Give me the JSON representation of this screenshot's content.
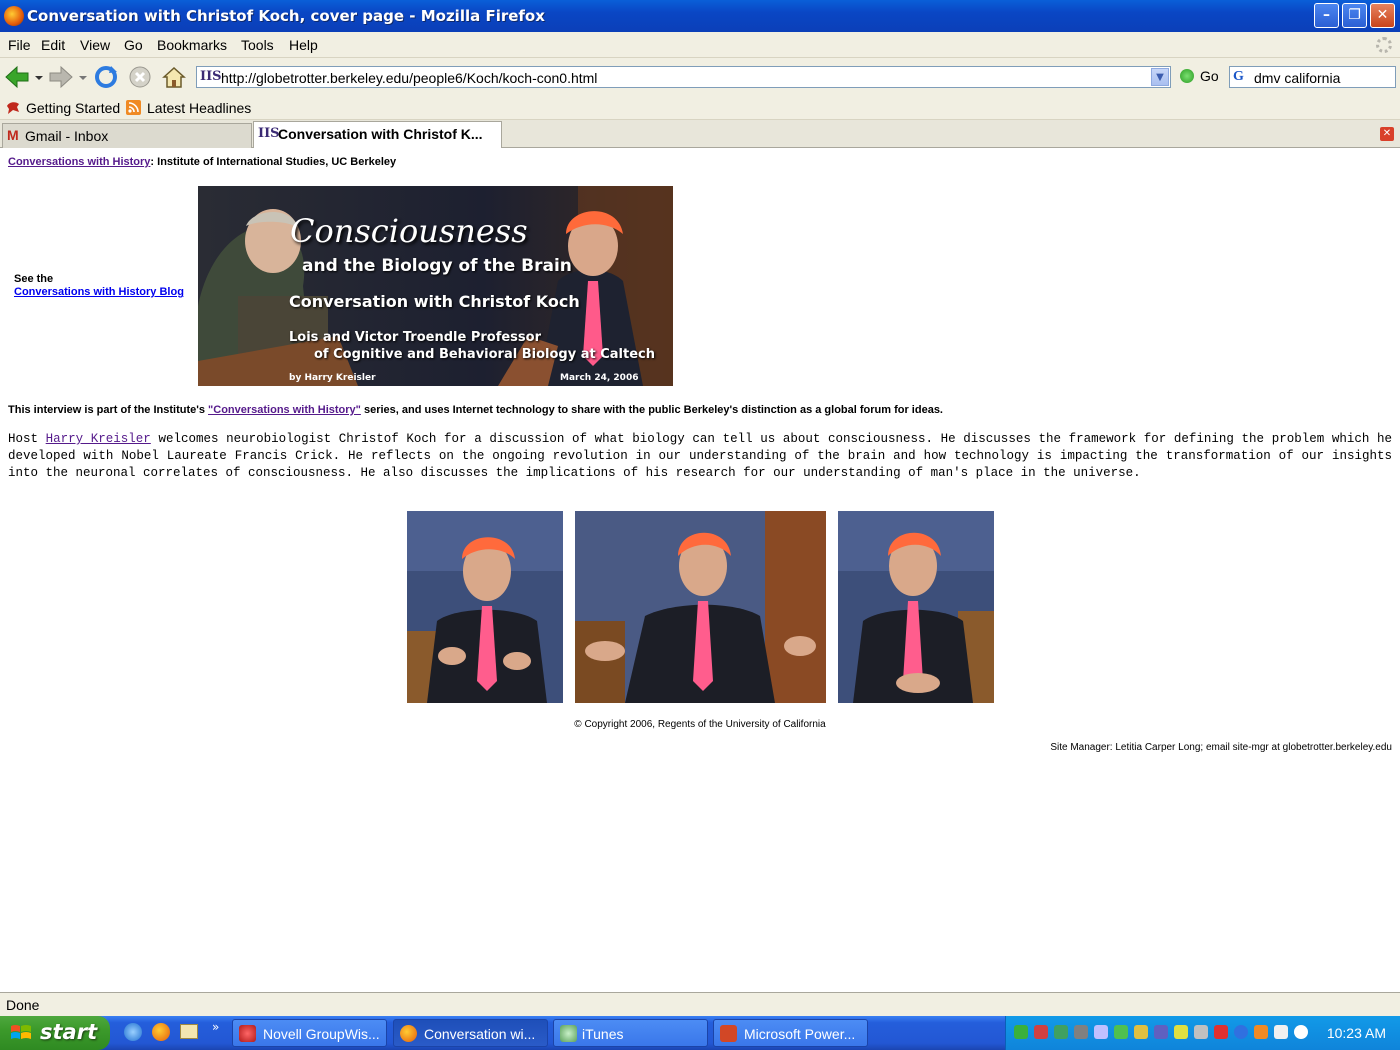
{
  "window": {
    "title": "Conversation with Christof Koch, cover page - Mozilla Firefox",
    "minimize": "–",
    "maximize": "❐",
    "close": "✕"
  },
  "menu": [
    "File",
    "Edit",
    "View",
    "Go",
    "Bookmarks",
    "Tools",
    "Help"
  ],
  "nav": {
    "url": "http://globetrotter.berkeley.edu/people6/Koch/koch-con0.html",
    "go_label": "Go",
    "search_value": "dmv california"
  },
  "bookmarks": [
    "Getting Started",
    "Latest Headlines"
  ],
  "tabs": [
    {
      "label": "Gmail - Inbox",
      "active": false
    },
    {
      "label": "Conversation with Christof K...",
      "active": true
    }
  ],
  "page": {
    "header_link": "Conversations with History",
    "header_rest": ": Institute of International Studies, UC Berkeley",
    "blog_prefix": "See the",
    "blog_link": "Conversations with History Blog",
    "banner": {
      "title": "Consciousness",
      "subtitle": "and the Biology of the Brain",
      "guest": "Conversation with Christof Koch",
      "position1": "Lois and Victor Troendle Professor",
      "position2": "of Cognitive and Behavioral Biology at Caltech",
      "host": "by Harry Kreisler",
      "date": "March 24, 2006"
    },
    "intro_before": "This interview is part of the Institute's ",
    "intro_link": "\"Conversations with History\"",
    "intro_after": " series, and uses Internet technology to share with the public Berkeley's distinction as a global forum for ideas.",
    "desc_before": "Host ",
    "desc_link": "Harry Kreisler",
    "desc_after": " welcomes neurobiologist Christof Koch for a discussion of what biology can tell us about consciousness. He discusses the framework for defining the problem which he developed with Nobel Laureate Francis Crick. He reflects on the ongoing revolution in our understanding of the brain and how technology is impacting the transformation of our insights into the neuronal correlates of consciousness. He also discusses the implications of his research for our understanding of man's place in the universe.",
    "copyright": "© Copyright 2006, Regents of the University of California",
    "site_manager": "Site Manager: Letitia Carper Long; email site-mgr at globetrotter.berkeley.edu"
  },
  "status": "Done",
  "taskbar": {
    "start": "start",
    "tasks": [
      {
        "label": "Novell GroupWis...",
        "icon": "groupwise-icon"
      },
      {
        "label": "Conversation wi...",
        "icon": "firefox-icon"
      },
      {
        "label": "iTunes",
        "icon": "itunes-icon"
      },
      {
        "label": "Microsoft Power...",
        "icon": "powerpoint-icon"
      }
    ],
    "clock": "10:23 AM"
  },
  "colors": {
    "link": "#551a8b",
    "xp_blue": "#245edb",
    "chrome": "#f1efe2"
  }
}
